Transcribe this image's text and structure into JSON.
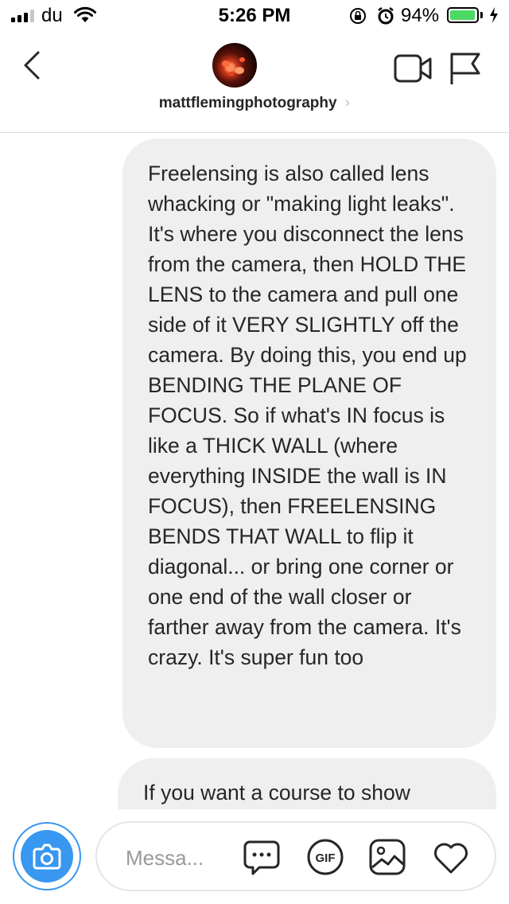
{
  "status_bar": {
    "carrier": "du",
    "time": "5:26 PM",
    "battery_percent": "94%",
    "battery_level": 0.94
  },
  "header": {
    "username": "mattflemingphotography",
    "chevron": "›",
    "icons": [
      "back-chevron-icon",
      "video-call-icon",
      "flag-icon"
    ]
  },
  "messages": [
    {
      "text": "Freelensing is also called lens whacking or \"making light leaks\". It's where you disconnect the lens from the camera, then HOLD THE LENS to the camera and pull one side of it VERY SLIGHTLY off the camera. By doing this, you end up BENDING THE PLANE OF FOCUS. So if what's IN focus is like a THICK WALL (where everything INSIDE the wall is IN FOCUS), then FREELENSING BENDS THAT WALL to flip it diagonal... or bring one corner or one end of the wall closer or farther away from the camera. It's crazy. It's super fun too"
    },
    {
      "text": "If you want a course to show"
    }
  ],
  "composer": {
    "placeholder": "Messa...",
    "gif_label": "GIF",
    "icons": [
      "camera-icon",
      "chat-bubble-icon",
      "gif-icon",
      "photo-icon",
      "heart-icon"
    ]
  },
  "colors": {
    "accent_blue": "#3897f0",
    "bubble_gray": "#efefef",
    "battery_green": "#4cd964"
  }
}
